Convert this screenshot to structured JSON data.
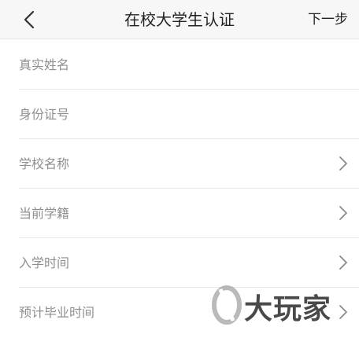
{
  "navbar": {
    "title": "在校大学生认证",
    "back_icon": "chevron-left-icon",
    "next_label": "下一步"
  },
  "form": {
    "rows": [
      {
        "label": "真实姓名",
        "has_chevron": false
      },
      {
        "label": "身份证号",
        "has_chevron": false
      },
      {
        "label": "学校名称",
        "has_chevron": true
      },
      {
        "label": "当前学籍",
        "has_chevron": true
      },
      {
        "label": "入学时间",
        "has_chevron": true
      },
      {
        "label": "预计毕业时间",
        "has_chevron": true
      }
    ]
  },
  "watermark": {
    "text": "大玩家"
  },
  "colors": {
    "navbar_bg": "#f7f7f7",
    "title_text": "#222222",
    "placeholder_text": "#8f8f8f",
    "divider": "#e8e8e8",
    "chevron": "#8a8a8a"
  }
}
